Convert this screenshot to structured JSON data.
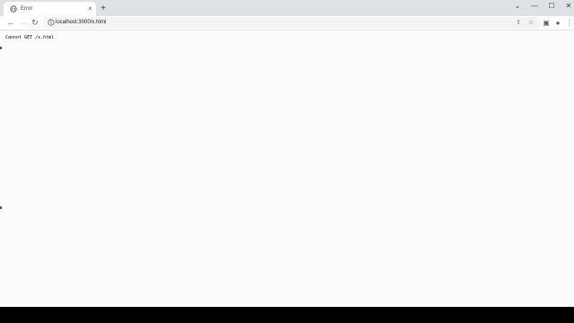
{
  "browser": {
    "tab": {
      "title": "Error",
      "favicon": "globe-icon",
      "close_icon": "×"
    },
    "new_tab_icon": "+",
    "window_controls": {
      "tab_search": "⌄",
      "minimize": "—",
      "maximize": "☐",
      "close": "✕"
    },
    "toolbar": {
      "back_icon": "←",
      "forward_icon": "→",
      "reload_icon": "↻",
      "url": "localhost:3000/x.html",
      "share_icon": "⇪",
      "bookmark_icon": "☆",
      "side_panel_icon": "▣",
      "profile_icon": "●",
      "menu_icon": "⋮"
    }
  },
  "page": {
    "message": "Cannot GET /x.html"
  }
}
